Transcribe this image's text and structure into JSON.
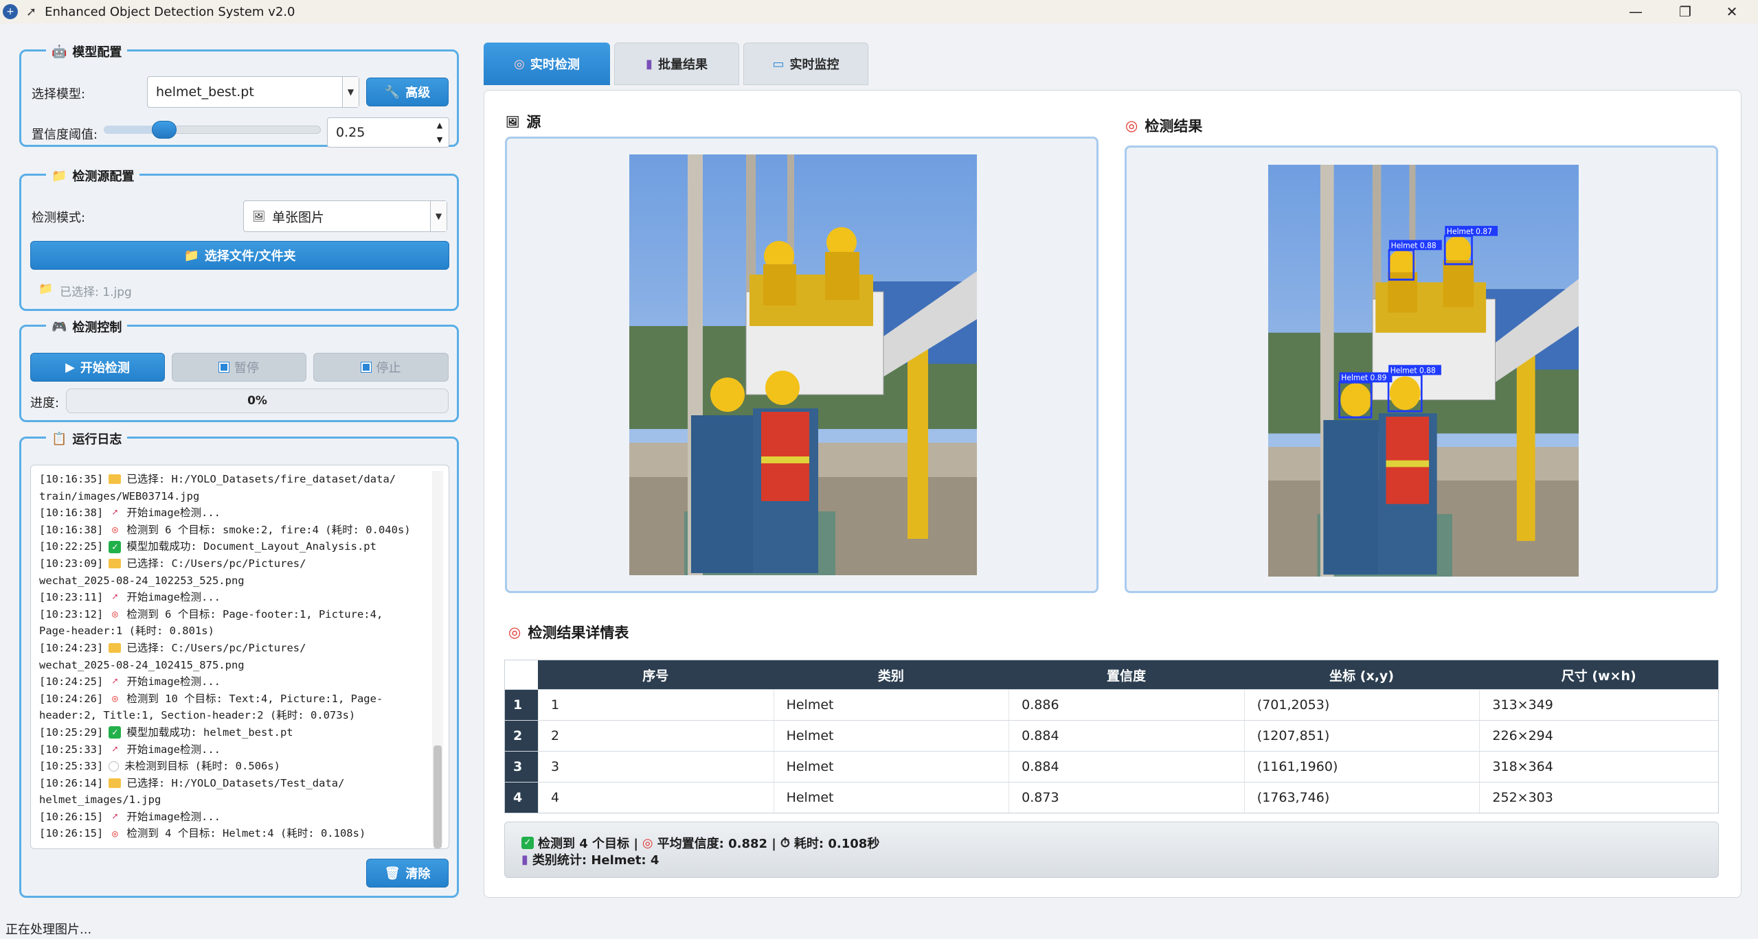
{
  "window": {
    "title": "Enhanced Object Detection System v2.0",
    "minimize": "—",
    "maximize": "❐",
    "close": "✕"
  },
  "model_config": {
    "title": "模型配置",
    "select_label": "选择模型:",
    "selected_model": "helmet_best.pt",
    "advanced_button": "高级",
    "confidence_label": "置信度阈值:",
    "confidence_value": "0.25",
    "confidence_level": 0.25
  },
  "source_config": {
    "title": "检测源配置",
    "mode_label": "检测模式:",
    "mode_value": "单张图片",
    "select_button": "选择文件/文件夹",
    "selected_text": "已选择: 1.jpg"
  },
  "detect_control": {
    "title": "检测控制",
    "start_button": "开始检测",
    "pause_button": "暂停",
    "stop_button": "停止",
    "progress_label": "进度:",
    "progress_text": "0%",
    "progress_value": 0
  },
  "log": {
    "title": "运行日志",
    "clear_button": "清除",
    "lines": [
      {
        "t": "[10:16:35]",
        "icon": "folder",
        "text": "已选择: H:/YOLO_Datasets/fire_dataset/data/"
      },
      {
        "t": "",
        "icon": "",
        "text": "train/images/WEB03714.jpg"
      },
      {
        "t": "[10:16:38]",
        "icon": "rocket",
        "text": "开始image检测..."
      },
      {
        "t": "[10:16:38]",
        "icon": "target",
        "text": "检测到 6 个目标: smoke:2, fire:4 (耗时: 0.040s)"
      },
      {
        "t": "[10:22:25]",
        "icon": "ok",
        "text": "模型加载成功: Document_Layout_Analysis.pt"
      },
      {
        "t": "[10:23:09]",
        "icon": "folder",
        "text": "已选择: C:/Users/pc/Pictures/"
      },
      {
        "t": "",
        "icon": "",
        "text": "wechat_2025-08-24_102253_525.png"
      },
      {
        "t": "[10:23:11]",
        "icon": "rocket",
        "text": "开始image检测..."
      },
      {
        "t": "[10:23:12]",
        "icon": "target",
        "text": "检测到 6 个目标: Page-footer:1, Picture:4,"
      },
      {
        "t": "",
        "icon": "",
        "text": "Page-header:1 (耗时: 0.801s)"
      },
      {
        "t": "[10:24:23]",
        "icon": "folder",
        "text": "已选择: C:/Users/pc/Pictures/"
      },
      {
        "t": "",
        "icon": "",
        "text": "wechat_2025-08-24_102415_875.png"
      },
      {
        "t": "[10:24:25]",
        "icon": "rocket",
        "text": "开始image检测..."
      },
      {
        "t": "[10:24:26]",
        "icon": "target",
        "text": "检测到 10 个目标: Text:4, Picture:1, Page-"
      },
      {
        "t": "",
        "icon": "",
        "text": "header:2, Title:1, Section-header:2 (耗时: 0.073s)"
      },
      {
        "t": "[10:25:29]",
        "icon": "ok",
        "text": "模型加载成功: helmet_best.pt"
      },
      {
        "t": "[10:25:33]",
        "icon": "rocket",
        "text": "开始image检测..."
      },
      {
        "t": "[10:25:33]",
        "icon": "circle",
        "text": "未检测到目标 (耗时: 0.506s)"
      },
      {
        "t": "[10:26:14]",
        "icon": "folder",
        "text": "已选择: H:/YOLO_Datasets/Test_data/"
      },
      {
        "t": "",
        "icon": "",
        "text": "helmet_images/1.jpg"
      },
      {
        "t": "[10:26:15]",
        "icon": "rocket",
        "text": "开始image检测..."
      },
      {
        "t": "[10:26:15]",
        "icon": "target",
        "text": "检测到 4 个目标: Helmet:4 (耗时: 0.108s)"
      }
    ]
  },
  "tabs": [
    {
      "label": "实时检测",
      "icon": "target-icon",
      "active": true
    },
    {
      "label": "批量结果",
      "icon": "chart-icon",
      "active": false
    },
    {
      "label": "实时监控",
      "icon": "monitor-icon",
      "active": false
    }
  ],
  "source_panel": {
    "title": "源"
  },
  "result_panel": {
    "title": "检测结果",
    "boxes": [
      {
        "label": "Helmet  0.88"
      },
      {
        "label": "Helmet  0.87"
      },
      {
        "label": "Helmet  0.89"
      },
      {
        "label": "Helmet  0.88"
      }
    ]
  },
  "details": {
    "title": "检测结果详情表",
    "columns": [
      "序号",
      "类别",
      "置信度",
      "坐标 (x,y)",
      "尺寸 (w×h)"
    ],
    "rows": [
      {
        "idx": "1",
        "seq": "1",
        "cls": "Helmet",
        "conf": "0.886",
        "coord": "(701,2053)",
        "size": "313×349"
      },
      {
        "idx": "2",
        "seq": "2",
        "cls": "Helmet",
        "conf": "0.884",
        "coord": "(1207,851)",
        "size": "226×294"
      },
      {
        "idx": "3",
        "seq": "3",
        "cls": "Helmet",
        "conf": "0.884",
        "coord": "(1161,1960)",
        "size": "318×364"
      },
      {
        "idx": "4",
        "seq": "4",
        "cls": "Helmet",
        "conf": "0.873",
        "coord": "(1763,746)",
        "size": "252×303"
      }
    ]
  },
  "summary": {
    "count_text": "检测到 4 个目标 |",
    "avg_text": "平均置信度: 0.882 |",
    "time_text": "耗时: 0.108秒",
    "category_text": "类别统计: Helmet: 4"
  },
  "status_bar": "正在处理图片...",
  "colors": {
    "accent": "#2a86d6",
    "header": "#2c3e50",
    "box": "#1f3bff"
  }
}
